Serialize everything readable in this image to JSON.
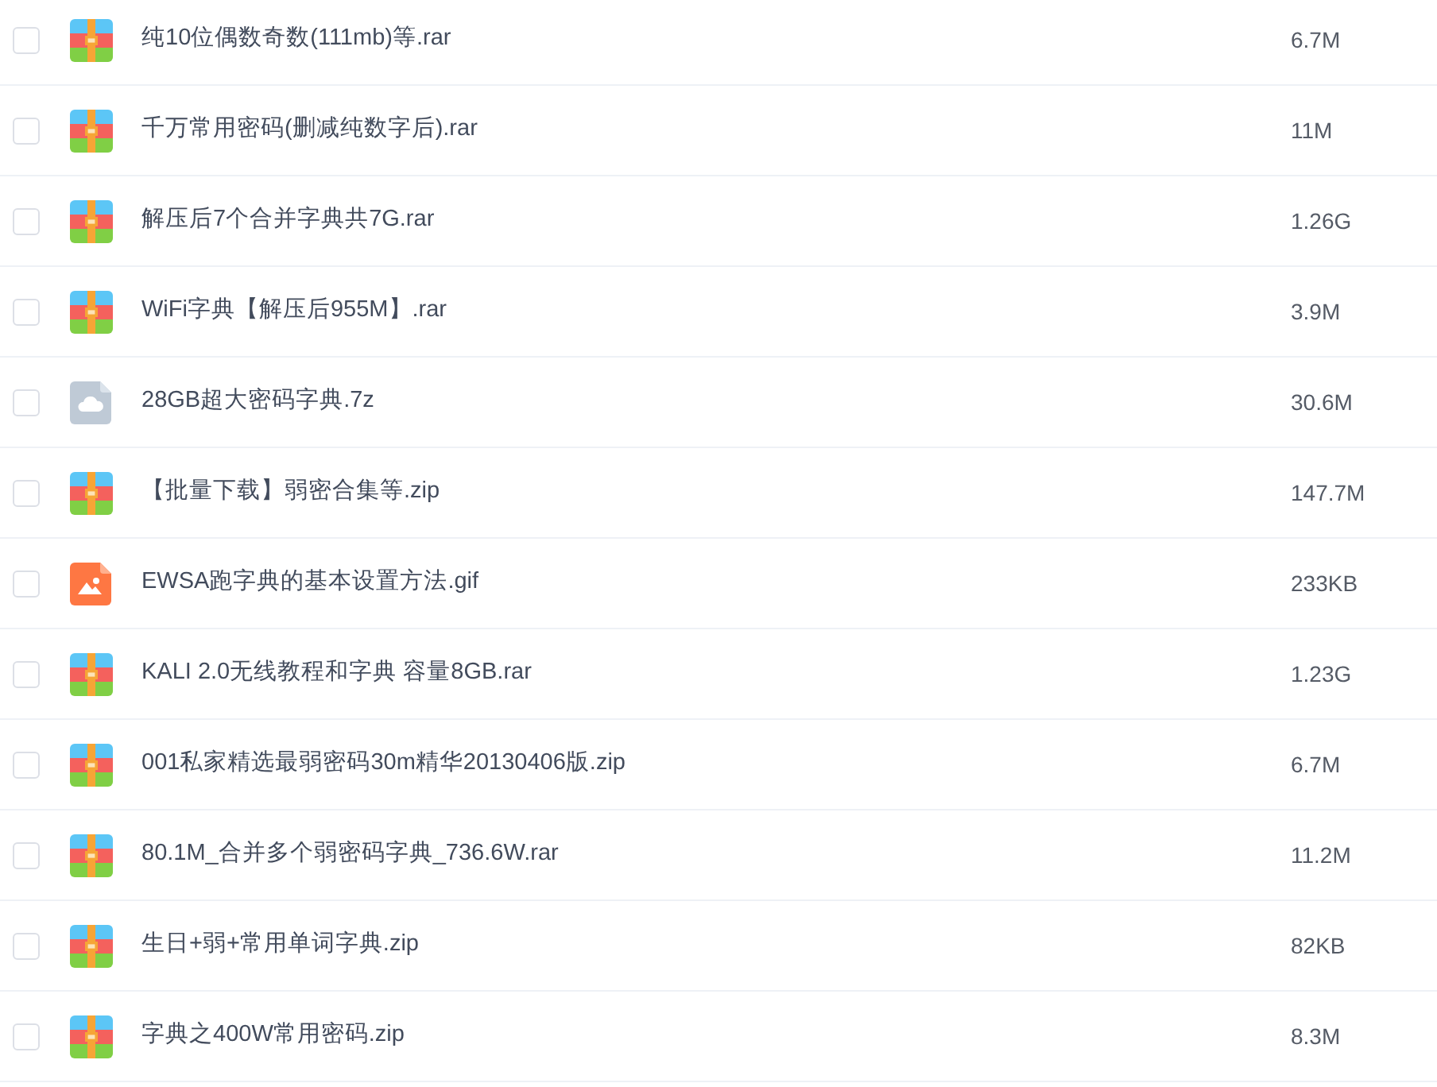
{
  "files": [
    {
      "kind": "archive",
      "name": "纯10位偶数奇数(111mb)等.rar",
      "size": "6.7M",
      "checked": false
    },
    {
      "kind": "archive",
      "name": "千万常用密码(删减纯数字后).rar",
      "size": "11M",
      "checked": false
    },
    {
      "kind": "archive",
      "name": "解压后7个合并字典共7G.rar",
      "size": "1.26G",
      "checked": false
    },
    {
      "kind": "archive",
      "name": "WiFi字典【解压后955M】.rar",
      "size": "3.9M",
      "checked": false
    },
    {
      "kind": "cloud",
      "name": "28GB超大密码字典.7z",
      "size": "30.6M",
      "checked": false
    },
    {
      "kind": "archive",
      "name": "【批量下载】弱密合集等.zip",
      "size": "147.7M",
      "checked": false
    },
    {
      "kind": "image",
      "name": "EWSA跑字典的基本设置方法.gif",
      "size": "233KB",
      "checked": false
    },
    {
      "kind": "archive",
      "name": "KALI 2.0无线教程和字典 容量8GB.rar",
      "size": "1.23G",
      "checked": false
    },
    {
      "kind": "archive",
      "name": "001私家精选最弱密码30m精华20130406版.zip",
      "size": "6.7M",
      "checked": false
    },
    {
      "kind": "archive",
      "name": "80.1M_合并多个弱密码字典_736.6W.rar",
      "size": "11.2M",
      "checked": false
    },
    {
      "kind": "archive",
      "name": "生日+弱+常用单词字典.zip",
      "size": "82KB",
      "checked": false
    },
    {
      "kind": "archive",
      "name": "字典之400W常用密码.zip",
      "size": "8.3M",
      "checked": false
    }
  ]
}
